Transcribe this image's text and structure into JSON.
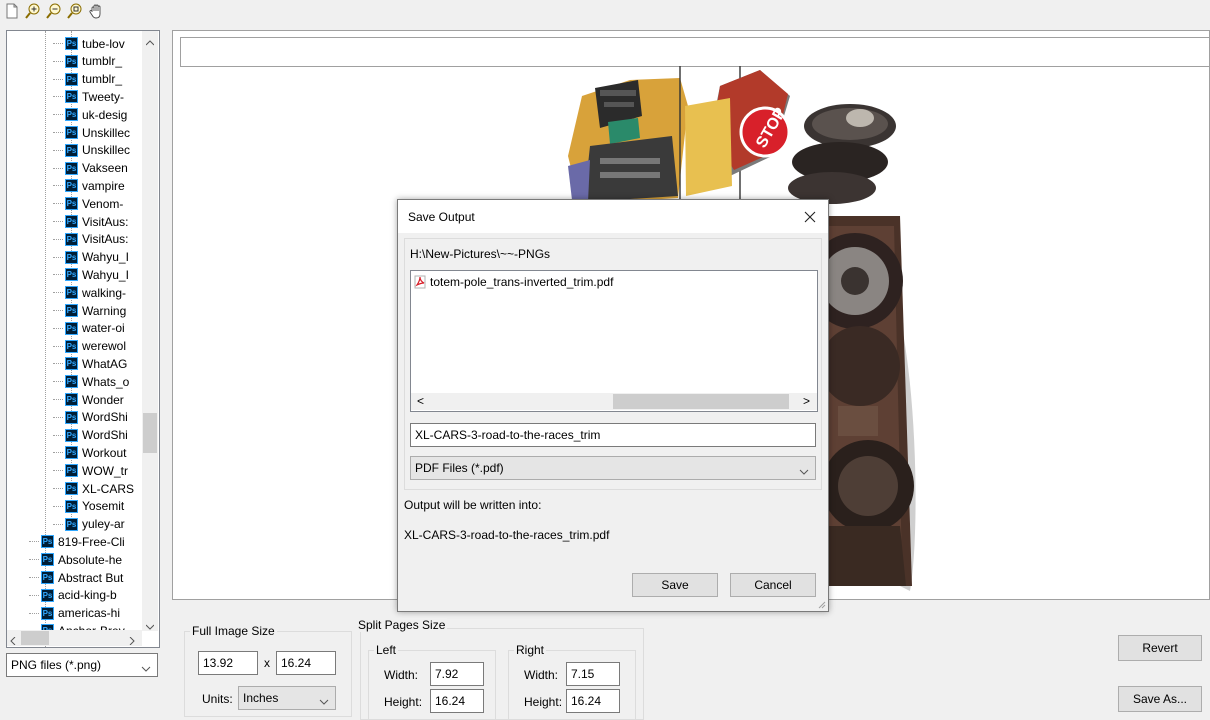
{
  "toolbar": {
    "icons": [
      "new-document-icon",
      "zoom-in-icon",
      "zoom-out-icon",
      "zoom-fit-icon",
      "pan-hand-icon"
    ]
  },
  "tree": {
    "nested_items": [
      "tube-lov",
      "tumblr_",
      "tumblr_",
      "Tweety-",
      "uk-desig",
      "Unskillec",
      "Unskillec",
      "Vakseen",
      "vampire",
      "Venom-",
      "VisitAus:",
      "VisitAus:",
      "Wahyu_I",
      "Wahyu_I",
      "walking-",
      "Warning",
      "water-oi",
      "werewol",
      "WhatAG",
      "Whats_o",
      "Wonder",
      "WordShi",
      "WordShi",
      "Workout",
      "WOW_tr",
      "XL-CARS",
      "Yosemit",
      "yuley-ar"
    ],
    "top_items": [
      "819-Free-Cli",
      "Absolute-he",
      "Abstract But",
      "acid-king-b",
      "americas-hi",
      "Anchor-Brev"
    ]
  },
  "file_filter": {
    "value": "PNG files (*.png)"
  },
  "dialog": {
    "title": "Save Output",
    "path": "H:\\New-Pictures\\~~-PNGs",
    "files": [
      "totem-pole_trans-inverted_trim.pdf"
    ],
    "filename": "XL-CARS-3-road-to-the-races_trim",
    "filetype": "PDF Files (*.pdf)",
    "output_label": "Output will be written into:",
    "output_file": "XL-CARS-3-road-to-the-races_trim.pdf",
    "save_label": "Save",
    "cancel_label": "Cancel",
    "scroll_left": "<",
    "scroll_right": ">"
  },
  "bottom": {
    "full_image_size_label": "Full Image Size",
    "width_value": "13.92",
    "x_sep": "x",
    "height_value": "16.24",
    "units_label": "Units:",
    "units_value": "Inches",
    "split_label": "Split Pages Size",
    "left_label": "Left",
    "right_label": "Right",
    "width_label": "Width:",
    "height_label": "Height:",
    "left_width": "7.92",
    "left_height": "16.24",
    "right_width": "7.15",
    "right_height": "16.24",
    "revert_label": "Revert",
    "save_as_label": "Save As..."
  }
}
